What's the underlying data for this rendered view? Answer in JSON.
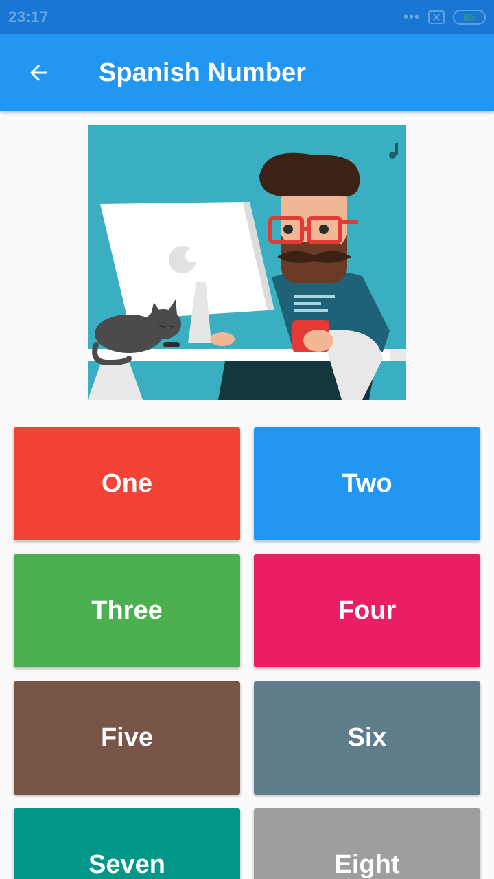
{
  "status_bar": {
    "time": "23:17",
    "dots": "•••",
    "battery": "85"
  },
  "app_bar": {
    "title": "Spanish Number",
    "back_icon": "arrow-left-icon"
  },
  "hero": {
    "description_icon": "developer-illustration"
  },
  "colors": {
    "app_bar": "#2196f3",
    "status_bar": "#1976d2",
    "one": "#f44336",
    "two": "#2196f3",
    "three": "#4caf50",
    "four": "#e91e63",
    "five": "#795548",
    "six": "#607d8b",
    "seven": "#009688",
    "eight": "#9e9e9e"
  },
  "numbers": [
    {
      "label": "One"
    },
    {
      "label": "Two"
    },
    {
      "label": "Three"
    },
    {
      "label": "Four"
    },
    {
      "label": "Five"
    },
    {
      "label": "Six"
    },
    {
      "label": "Seven"
    },
    {
      "label": "Eight"
    }
  ]
}
